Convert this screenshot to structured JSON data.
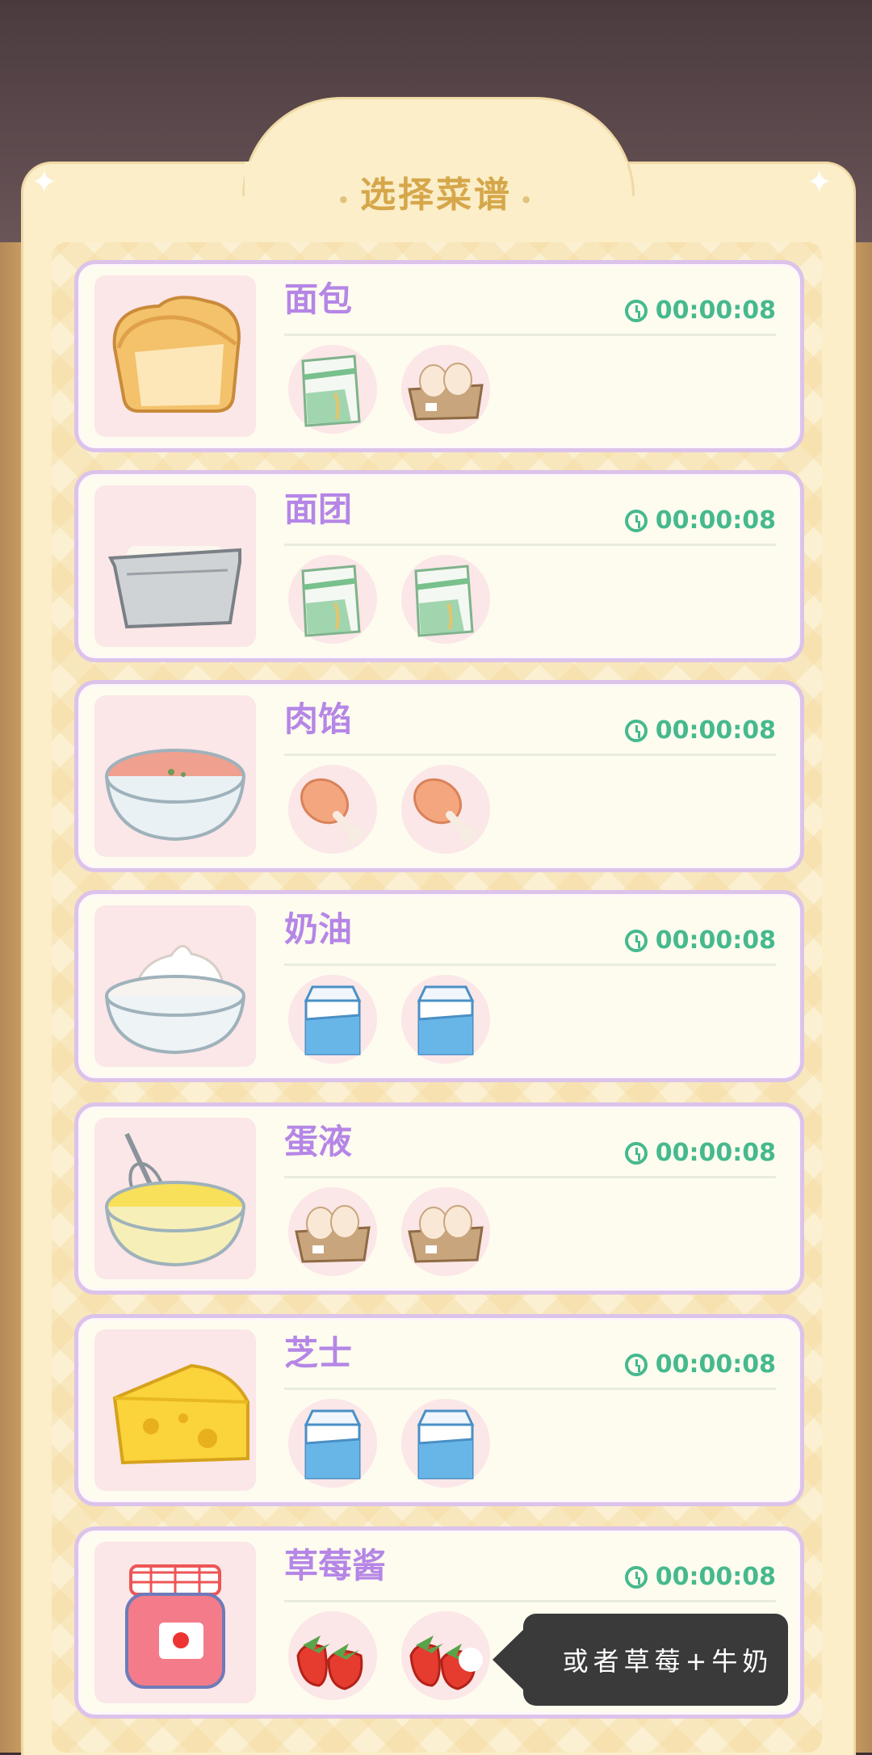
{
  "header": {
    "title": "选择菜谱"
  },
  "recipes": [
    {
      "name": "面包",
      "time": "00:00:08",
      "image": "bread-icon",
      "ingredients": [
        "flour-bag-icon",
        "egg-carton-icon"
      ]
    },
    {
      "name": "面团",
      "time": "00:00:08",
      "image": "dough-tin-icon",
      "ingredients": [
        "flour-bag-icon",
        "flour-bag-icon"
      ]
    },
    {
      "name": "肉馅",
      "time": "00:00:08",
      "image": "meat-filling-icon",
      "ingredients": [
        "chicken-leg-icon",
        "chicken-leg-icon"
      ]
    },
    {
      "name": "奶油",
      "time": "00:00:08",
      "image": "cream-icon",
      "ingredients": [
        "milk-carton-icon",
        "milk-carton-icon"
      ]
    },
    {
      "name": "蛋液",
      "time": "00:00:08",
      "image": "egg-liquid-icon",
      "ingredients": [
        "egg-carton-icon",
        "egg-carton-icon"
      ]
    },
    {
      "name": "芝士",
      "time": "00:00:08",
      "image": "cheese-icon",
      "ingredients": [
        "milk-carton-icon",
        "milk-carton-icon"
      ]
    },
    {
      "name": "草莓酱",
      "time": "00:00:08",
      "image": "strawberry-jam-icon",
      "ingredients": [
        "strawberry-icon",
        "strawberry-icon"
      ]
    }
  ],
  "tooltip": {
    "text": "或者草莓+牛奶"
  },
  "colors": {
    "name": "#b586e6",
    "timer": "#46b98e",
    "card_border": "#dcc3ea",
    "title": "#d6a74a"
  }
}
